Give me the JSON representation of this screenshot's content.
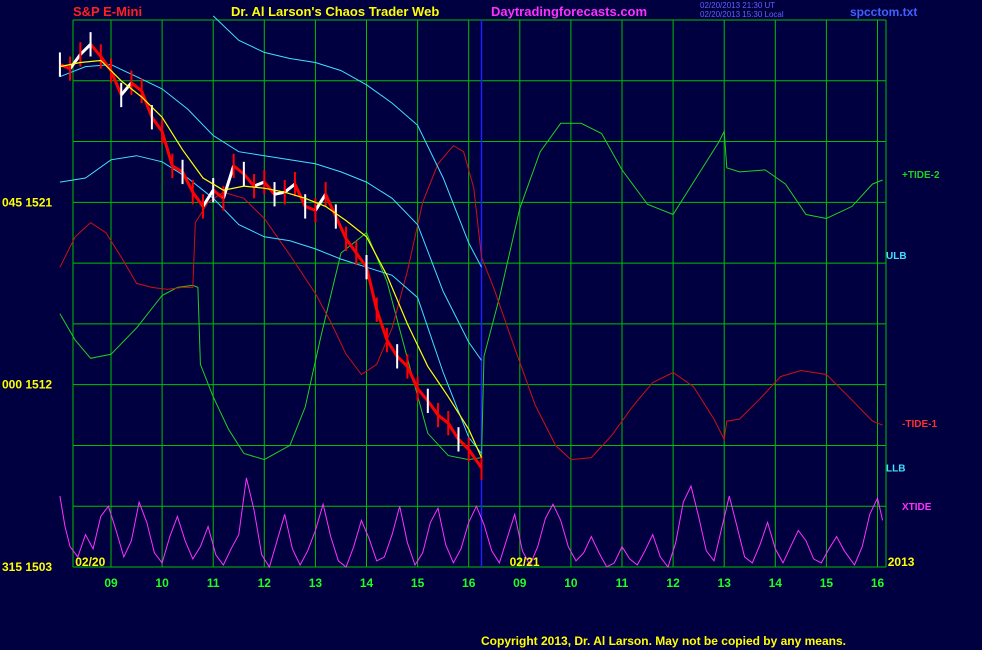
{
  "header": {
    "symbol": "S&P E-Mini",
    "title": "Dr. Al Larson's Chaos Trader Web",
    "site": "Daytradingforecasts.com",
    "timestamp_ut": "02/20/2013 21:30 UT",
    "timestamp_local": "02/20/2013 15:30 Local",
    "file": "spcctom.txt"
  },
  "footer": {
    "copyright": "Copyright 2013, Dr. Al Larson. May not be copied by any means."
  },
  "colors": {
    "background": "#000040",
    "grid": "#00c000",
    "price_up": "#ffffff",
    "price_down": "#ff0000",
    "moving_average": "#ffff00",
    "bands": "#40e0ff",
    "tide_2": "#20d020",
    "tide_1": "#d01010",
    "xtide": "#ff30ff",
    "day_divider": "#2020ff"
  },
  "chart_data": {
    "type": "line",
    "title": "S&P E-Mini",
    "ylim": [
      1503,
      1530
    ],
    "y_ticks": [
      {
        "value": 1521,
        "label": "045 1521"
      },
      {
        "value": 1512,
        "label": "000 1512"
      },
      {
        "value": 1503,
        "label": "315 1503"
      }
    ],
    "x_range_hours": [
      0,
      31.7
    ],
    "x_ticks": [
      {
        "x": 1,
        "label": "09"
      },
      {
        "x": 2,
        "label": "10"
      },
      {
        "x": 3,
        "label": "11"
      },
      {
        "x": 4,
        "label": "12"
      },
      {
        "x": 5,
        "label": "13"
      },
      {
        "x": 6,
        "label": "14"
      },
      {
        "x": 7,
        "label": "15"
      },
      {
        "x": 8,
        "label": "16"
      },
      {
        "x": 9,
        "label": "09"
      },
      {
        "x": 10,
        "label": "10"
      },
      {
        "x": 11,
        "label": "11"
      },
      {
        "x": 12,
        "label": "12"
      },
      {
        "x": 13,
        "label": "13"
      },
      {
        "x": 14,
        "label": "14"
      },
      {
        "x": 15,
        "label": "15"
      },
      {
        "x": 16,
        "label": "16"
      }
    ],
    "date_labels": [
      {
        "x": 0.3,
        "label": "02/20"
      },
      {
        "x": 8.8,
        "label": "02/21"
      },
      {
        "x": 16.2,
        "label": "2013"
      }
    ],
    "day_divider_x": 8.25,
    "grid": true,
    "series": [
      {
        "name": "Price",
        "kind": "price",
        "x": [
          0,
          0.2,
          0.4,
          0.6,
          0.8,
          1.0,
          1.2,
          1.4,
          1.6,
          1.8,
          2.0,
          2.2,
          2.4,
          2.6,
          2.8,
          3.0,
          3.2,
          3.4,
          3.6,
          3.8,
          4.0,
          4.2,
          4.4,
          4.6,
          4.8,
          5.0,
          5.2,
          5.4,
          5.6,
          5.8,
          6.0,
          6.2,
          6.4,
          6.6,
          6.8,
          7.0,
          7.2,
          7.4,
          7.6,
          7.8,
          8.0,
          8.25
        ],
        "y": [
          1527.8,
          1527.6,
          1528.3,
          1528.8,
          1528.2,
          1527.5,
          1526.3,
          1526.9,
          1526.5,
          1525.2,
          1524.5,
          1522.8,
          1522.5,
          1521.5,
          1520.8,
          1521.6,
          1521.2,
          1522.8,
          1522.4,
          1521.8,
          1522.0,
          1521.4,
          1521.5,
          1521.9,
          1520.8,
          1520.6,
          1521.4,
          1520.3,
          1519.2,
          1518.5,
          1517.8,
          1515.7,
          1514.2,
          1513.4,
          1512.9,
          1511.8,
          1511.2,
          1510.5,
          1510.1,
          1509.3,
          1508.8,
          1507.9
        ]
      },
      {
        "name": "Moving average",
        "kind": "ma",
        "x": [
          0,
          0.4,
          0.8,
          1.2,
          1.6,
          2.0,
          2.4,
          2.8,
          3.2,
          3.6,
          4.0,
          4.4,
          4.8,
          5.2,
          5.6,
          6.0,
          6.4,
          6.8,
          7.2,
          7.6,
          8.0,
          8.25
        ],
        "y": [
          1527.7,
          1527.9,
          1528.0,
          1527.0,
          1526.2,
          1525.2,
          1523.6,
          1522.2,
          1521.6,
          1521.8,
          1521.7,
          1521.5,
          1521.2,
          1520.8,
          1520.1,
          1519.3,
          1517.4,
          1515.0,
          1512.9,
          1511.4,
          1509.8,
          1508.4
        ]
      },
      {
        "name": "ULB",
        "kind": "band",
        "x": [
          3.0,
          3.5,
          4.0,
          4.5,
          5.0,
          5.5,
          6.0,
          6.5,
          7.0,
          7.5,
          8.0,
          8.25
        ],
        "y": [
          1530.2,
          1529.0,
          1528.4,
          1528.1,
          1527.9,
          1527.5,
          1526.8,
          1525.9,
          1524.8,
          1522.2,
          1519.0,
          1517.8
        ]
      },
      {
        "name": "Mid band",
        "kind": "band",
        "x": [
          0,
          0.5,
          1.0,
          1.5,
          2.0,
          2.5,
          3.0,
          3.5,
          4.0,
          4.5,
          5.0,
          5.5,
          6.0,
          6.5,
          7.0,
          7.5,
          8.0,
          8.25
        ],
        "y": [
          1527.2,
          1527.7,
          1527.8,
          1527.2,
          1526.6,
          1525.6,
          1524.3,
          1523.5,
          1523.3,
          1523.1,
          1522.9,
          1522.5,
          1522.0,
          1521.2,
          1519.9,
          1516.6,
          1514.1,
          1513.2
        ]
      },
      {
        "name": "LLB",
        "kind": "band",
        "x": [
          0,
          0.5,
          1.0,
          1.5,
          2.0,
          2.5,
          3.0,
          3.5,
          4.0,
          4.5,
          5.0,
          5.5,
          6.0,
          6.5,
          7.0,
          7.5,
          8.0,
          8.25
        ],
        "y": [
          1522.0,
          1522.2,
          1523.1,
          1523.3,
          1523.0,
          1522.2,
          1521.2,
          1519.9,
          1519.3,
          1519.1,
          1518.7,
          1518.2,
          1517.8,
          1517.4,
          1516.3,
          1512.6,
          1509.4,
          1508.6
        ]
      },
      {
        "name": "+TIDE-2",
        "kind": "tide2",
        "x": [
          0,
          0.3,
          0.6,
          1.0,
          1.5,
          2.0,
          2.3,
          2.6,
          2.7,
          2.75,
          3.0,
          3.3,
          3.6,
          4.0,
          4.5,
          4.8,
          5.1,
          5.5,
          6.0,
          6.4,
          6.8,
          7.2,
          7.6,
          8.0,
          8.25,
          8.3,
          8.6,
          9.0,
          9.4,
          9.8,
          10.2,
          10.6,
          11.0,
          11.5,
          12.0,
          12.4,
          12.9,
          13.0,
          13.05,
          13.3,
          13.8,
          14.2,
          14.6,
          15.0,
          15.5,
          15.9,
          16.1
        ],
        "y": [
          1515.5,
          1514.2,
          1513.3,
          1513.5,
          1514.8,
          1516.4,
          1516.8,
          1516.9,
          1516.8,
          1513.0,
          1511.4,
          1509.8,
          1508.6,
          1508.3,
          1509.0,
          1510.9,
          1514.3,
          1518.5,
          1519.5,
          1517.1,
          1513.3,
          1509.6,
          1508.5,
          1508.3,
          1508.4,
          1513.4,
          1516.3,
          1520.7,
          1523.5,
          1524.9,
          1524.9,
          1524.4,
          1522.6,
          1520.9,
          1520.4,
          1522.0,
          1524.0,
          1524.5,
          1522.7,
          1522.5,
          1522.6,
          1521.9,
          1520.4,
          1520.2,
          1520.8,
          1521.9,
          1522.1
        ]
      },
      {
        "name": "-TIDE-1",
        "kind": "tide1",
        "x": [
          0,
          0.3,
          0.6,
          0.9,
          1.2,
          1.5,
          1.8,
          2.1,
          2.4,
          2.6,
          2.65,
          2.9,
          3.2,
          3.6,
          4.0,
          4.5,
          5.0,
          5.3,
          5.6,
          5.9,
          6.2,
          6.5,
          6.8,
          7.1,
          7.4,
          7.7,
          7.9,
          8.1,
          8.25,
          8.5,
          8.9,
          9.3,
          9.7,
          10.0,
          10.4,
          10.8,
          11.2,
          11.6,
          12.0,
          12.4,
          12.8,
          13.0,
          13.05,
          13.3,
          13.7,
          14.1,
          14.5,
          15.0,
          15.4,
          15.9,
          16.1
        ],
        "y": [
          1517.8,
          1519.3,
          1520.0,
          1519.5,
          1518.3,
          1517.0,
          1516.8,
          1516.7,
          1516.8,
          1516.8,
          1520.0,
          1521.0,
          1521.5,
          1521.2,
          1520.2,
          1518.4,
          1516.5,
          1515.1,
          1513.5,
          1512.5,
          1513.0,
          1514.8,
          1517.6,
          1521.0,
          1522.9,
          1523.8,
          1523.5,
          1521.7,
          1518.3,
          1516.7,
          1513.8,
          1511.0,
          1509.0,
          1508.3,
          1508.4,
          1509.5,
          1510.9,
          1512.1,
          1512.6,
          1511.9,
          1510.3,
          1509.3,
          1510.2,
          1510.3,
          1511.3,
          1512.4,
          1512.7,
          1512.5,
          1511.5,
          1510.2,
          1510.0
        ]
      },
      {
        "name": "XTIDE",
        "kind": "xtide",
        "x": [
          0.0,
          0.1,
          0.2,
          0.35,
          0.5,
          0.65,
          0.8,
          0.95,
          1.1,
          1.25,
          1.4,
          1.55,
          1.7,
          1.85,
          2.0,
          2.15,
          2.3,
          2.45,
          2.6,
          2.75,
          2.9,
          3.05,
          3.2,
          3.35,
          3.5,
          3.65,
          3.8,
          3.95,
          4.1,
          4.25,
          4.4,
          4.55,
          4.7,
          4.85,
          5.0,
          5.15,
          5.3,
          5.45,
          5.6,
          5.75,
          5.9,
          6.05,
          6.2,
          6.35,
          6.5,
          6.65,
          6.8,
          6.95,
          7.1,
          7.25,
          7.4,
          7.55,
          7.7,
          7.85,
          8.0,
          8.15,
          8.3,
          8.45,
          8.6,
          8.75,
          8.9,
          9.05,
          9.2,
          9.35,
          9.5,
          9.65,
          9.8,
          9.95,
          10.1,
          10.25,
          10.4,
          10.55,
          10.7,
          10.85,
          11.0,
          11.15,
          11.3,
          11.45,
          11.6,
          11.75,
          11.9,
          12.05,
          12.2,
          12.35,
          12.5,
          12.65,
          12.8,
          12.95,
          13.1,
          13.25,
          13.4,
          13.55,
          13.7,
          13.85,
          14.0,
          14.15,
          14.3,
          14.45,
          14.6,
          14.75,
          14.9,
          15.05,
          15.2,
          15.35,
          15.55,
          15.7,
          15.85,
          16.0,
          16.1
        ],
        "y": [
          1506.5,
          1505.0,
          1504.0,
          1503.5,
          1504.6,
          1503.9,
          1505.5,
          1506.0,
          1504.8,
          1503.5,
          1504.3,
          1506.2,
          1505.2,
          1503.7,
          1503.2,
          1504.5,
          1505.5,
          1504.3,
          1503.4,
          1504.0,
          1505.0,
          1503.6,
          1503.1,
          1503.9,
          1504.6,
          1507.4,
          1505.8,
          1503.6,
          1503.0,
          1504.3,
          1505.6,
          1503.9,
          1503.1,
          1503.8,
          1504.8,
          1506.1,
          1504.5,
          1503.3,
          1503.0,
          1504.0,
          1505.3,
          1504.4,
          1503.3,
          1503.5,
          1504.6,
          1506.0,
          1504.2,
          1503.1,
          1503.7,
          1505.2,
          1505.9,
          1504.1,
          1503.2,
          1503.9,
          1505.2,
          1506.0,
          1505.1,
          1503.8,
          1503.2,
          1504.4,
          1505.6,
          1503.8,
          1503.1,
          1504.0,
          1505.4,
          1506.1,
          1505.3,
          1504.0,
          1503.3,
          1503.7,
          1504.5,
          1503.7,
          1503.0,
          1503.2,
          1504.0,
          1503.4,
          1503.1,
          1503.8,
          1504.6,
          1503.5,
          1503.0,
          1504.2,
          1506.2,
          1507.0,
          1505.5,
          1503.8,
          1503.3,
          1504.9,
          1506.5,
          1505.0,
          1503.5,
          1503.2,
          1504.1,
          1505.2,
          1503.9,
          1503.2,
          1504.0,
          1504.8,
          1504.3,
          1503.4,
          1503.2,
          1503.9,
          1504.5,
          1503.8,
          1503.1,
          1504.0,
          1505.6,
          1506.4,
          1505.3
        ]
      }
    ],
    "line_labels": [
      {
        "series": "+TIDE-2",
        "label": "+TIDE-2",
        "y": 1522.4
      },
      {
        "series": "ULB",
        "label": "ULB",
        "y": 1518.4
      },
      {
        "series": "-TIDE-1",
        "label": "-TIDE-1",
        "y": 1510.1
      },
      {
        "series": "LLB",
        "label": "LLB",
        "y": 1507.9
      },
      {
        "series": "XTIDE",
        "label": "XTIDE",
        "y": 1506.0
      }
    ]
  }
}
